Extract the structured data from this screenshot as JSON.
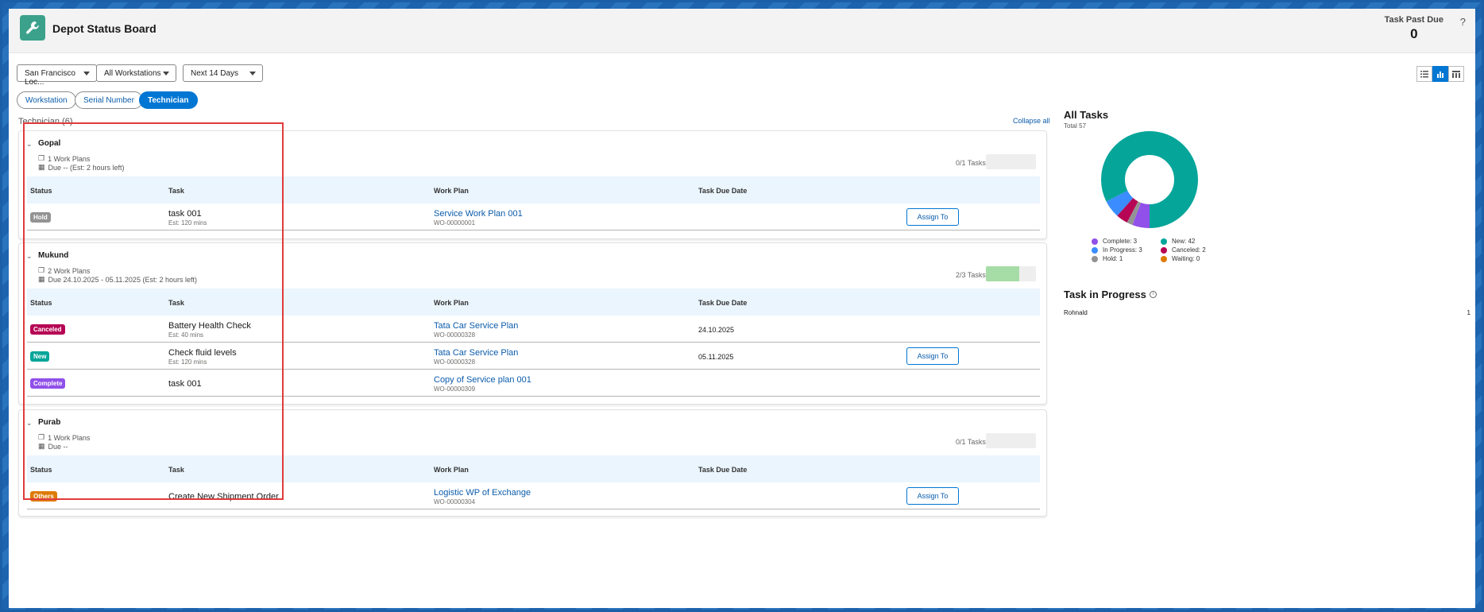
{
  "app": {
    "title": "Depot Status Board",
    "icon": "wrench-icon"
  },
  "past_due": {
    "label": "Task Past Due",
    "value": "0"
  },
  "help": "?",
  "filters": {
    "location": "San Francisco Loc...",
    "workstation": "All Workstations",
    "range": "Next 14 Days"
  },
  "group_tabs": [
    {
      "label": "Workstation",
      "active": false
    },
    {
      "label": "Serial Number",
      "active": false
    },
    {
      "label": "Technician",
      "active": true
    }
  ],
  "section": {
    "title": "Technician (6)",
    "collapse_label": "Collapse all"
  },
  "columns": {
    "status": "Status",
    "task": "Task",
    "work_plan": "Work Plan",
    "due_date": "Task Due Date"
  },
  "assign_label": "Assign To",
  "technicians": [
    {
      "name": "Gopal",
      "work_plans": "1 Work Plans",
      "due": "Due -- (Est: 2 hours left)",
      "tasks_count": "0/1 Tasks",
      "progress": 0,
      "rows": [
        {
          "status": "Hold",
          "status_color": "#939393",
          "task": "task 001",
          "est": "Est: 120 mins",
          "work_plan": "Service Work Plan 001",
          "wo": "WO-00000001",
          "due_date": "",
          "assign": true
        }
      ]
    },
    {
      "name": "Mukund",
      "work_plans": "2 Work Plans",
      "due": "Due 24.10.2025 - 05.11.2025 (Est: 2 hours left)",
      "tasks_count": "2/3 Tasks",
      "progress": 0.667,
      "rows": [
        {
          "status": "Canceled",
          "status_color": "#b60554",
          "task": "Battery Health Check",
          "est": "Est: 40 mins",
          "work_plan": "Tata Car Service Plan",
          "wo": "WO-00000328",
          "due_date": "24.10.2025",
          "assign": false
        },
        {
          "status": "New",
          "status_color": "#06a59a",
          "task": "Check fluid levels",
          "est": "Est: 120 mins",
          "work_plan": "Tata Car Service Plan",
          "wo": "WO-00000328",
          "due_date": "05.11.2025",
          "assign": true
        },
        {
          "status": "Complete",
          "status_color": "#9050e9",
          "task": "task 001",
          "est": "",
          "work_plan": "Copy of Service plan 001",
          "wo": "WO-00000309",
          "due_date": "",
          "assign": false
        }
      ]
    },
    {
      "name": "Purab",
      "work_plans": "1 Work Plans",
      "due": "Due --",
      "tasks_count": "0/1 Tasks",
      "progress": 0,
      "rows": [
        {
          "status": "Others",
          "status_color": "#dd7a01",
          "task": "Create New Shipment Order",
          "est": "",
          "work_plan": "Logistic WP of Exchange",
          "wo": "WO-00000304",
          "due_date": "",
          "assign": true
        }
      ]
    }
  ],
  "all_tasks": {
    "title": "All Tasks",
    "total": "Total 57",
    "legend": [
      {
        "label": "Complete: 3",
        "value": 3,
        "color": "#9050e9"
      },
      {
        "label": "New: 42",
        "value": 42,
        "color": "#06a59a"
      },
      {
        "label": "In Progress: 3",
        "value": 3,
        "color": "#3b8cff"
      },
      {
        "label": "Canceled: 2",
        "value": 2,
        "color": "#b60554"
      },
      {
        "label": "Hold: 1",
        "value": 1,
        "color": "#939393"
      },
      {
        "label": "Waiting: 0",
        "value": 0,
        "color": "#dd7a01"
      }
    ]
  },
  "task_in_progress": {
    "title": "Task in Progress",
    "rows": [
      {
        "name": "Rohnald",
        "value": "1"
      }
    ]
  }
}
